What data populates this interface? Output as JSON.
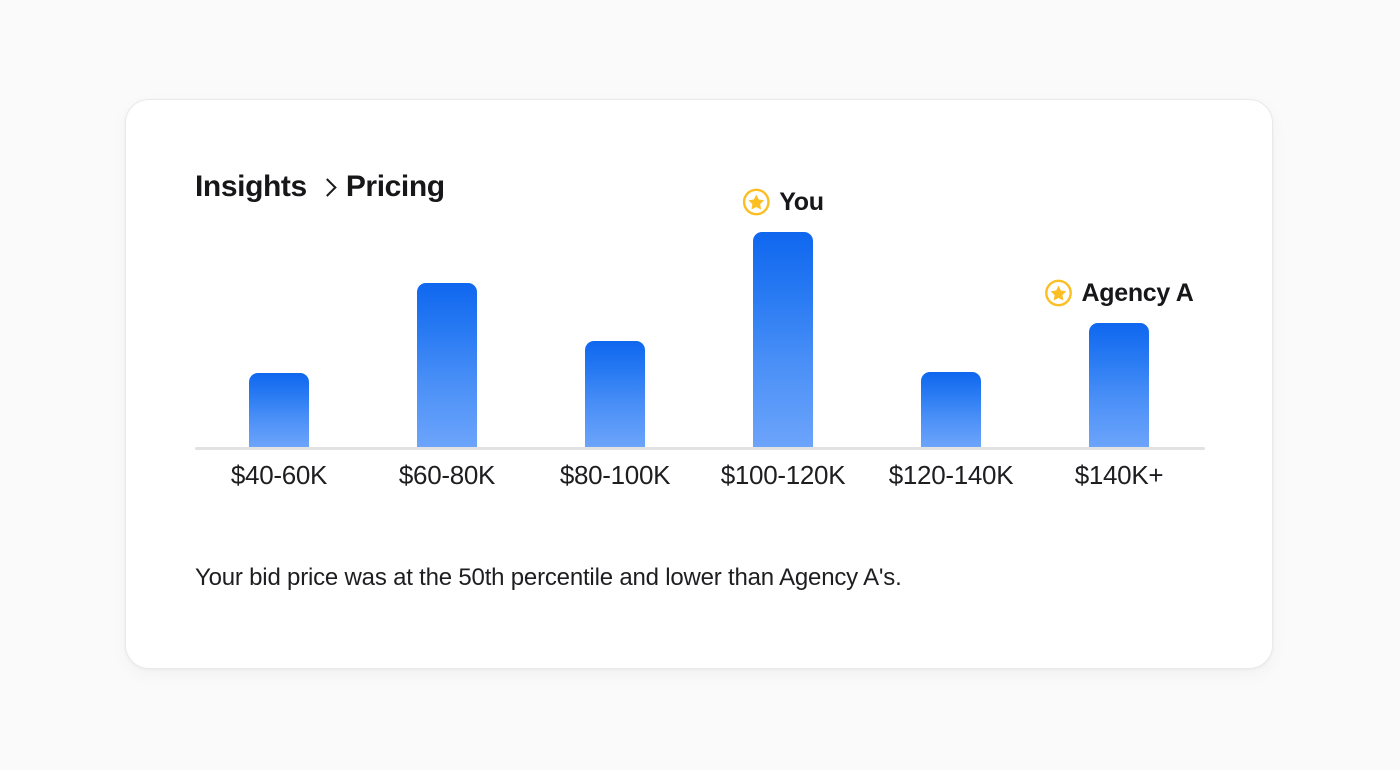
{
  "card": {
    "breadcrumb": {
      "root_label": "Insights",
      "separator_icon": "chevron-right-icon",
      "current_label": "Pricing"
    },
    "caption": "Your bid price was at the 50th percentile and lower than Agency A's."
  },
  "chart_data": {
    "type": "bar",
    "title": "",
    "subtitle": "",
    "xlabel": "",
    "ylabel": "",
    "grid": false,
    "legend": "none",
    "ylim": [
      0,
      200
    ],
    "categories": [
      "$40-60K",
      "$60-80K",
      "$80-100K",
      "$100-120K",
      "$120-140K",
      "$140K+"
    ],
    "values": [
      66,
      146,
      94,
      191,
      67,
      110
    ],
    "annotations": [
      {
        "category": "$100-120K",
        "index": 3,
        "label": "You",
        "icon": "star-circle-icon"
      },
      {
        "category": "$140K+",
        "index": 5,
        "label": "Agency A",
        "icon": "star-circle-icon"
      }
    ],
    "colors": {
      "bar_gradient_top": "#0f67ef",
      "bar_gradient_bottom": "#6ca4fb",
      "baseline": "#e2e2e4",
      "marker_accent": "#fbbf24",
      "text": "#1e1e21",
      "card_background": "#ffffff",
      "page_background": "#fafafa"
    }
  }
}
